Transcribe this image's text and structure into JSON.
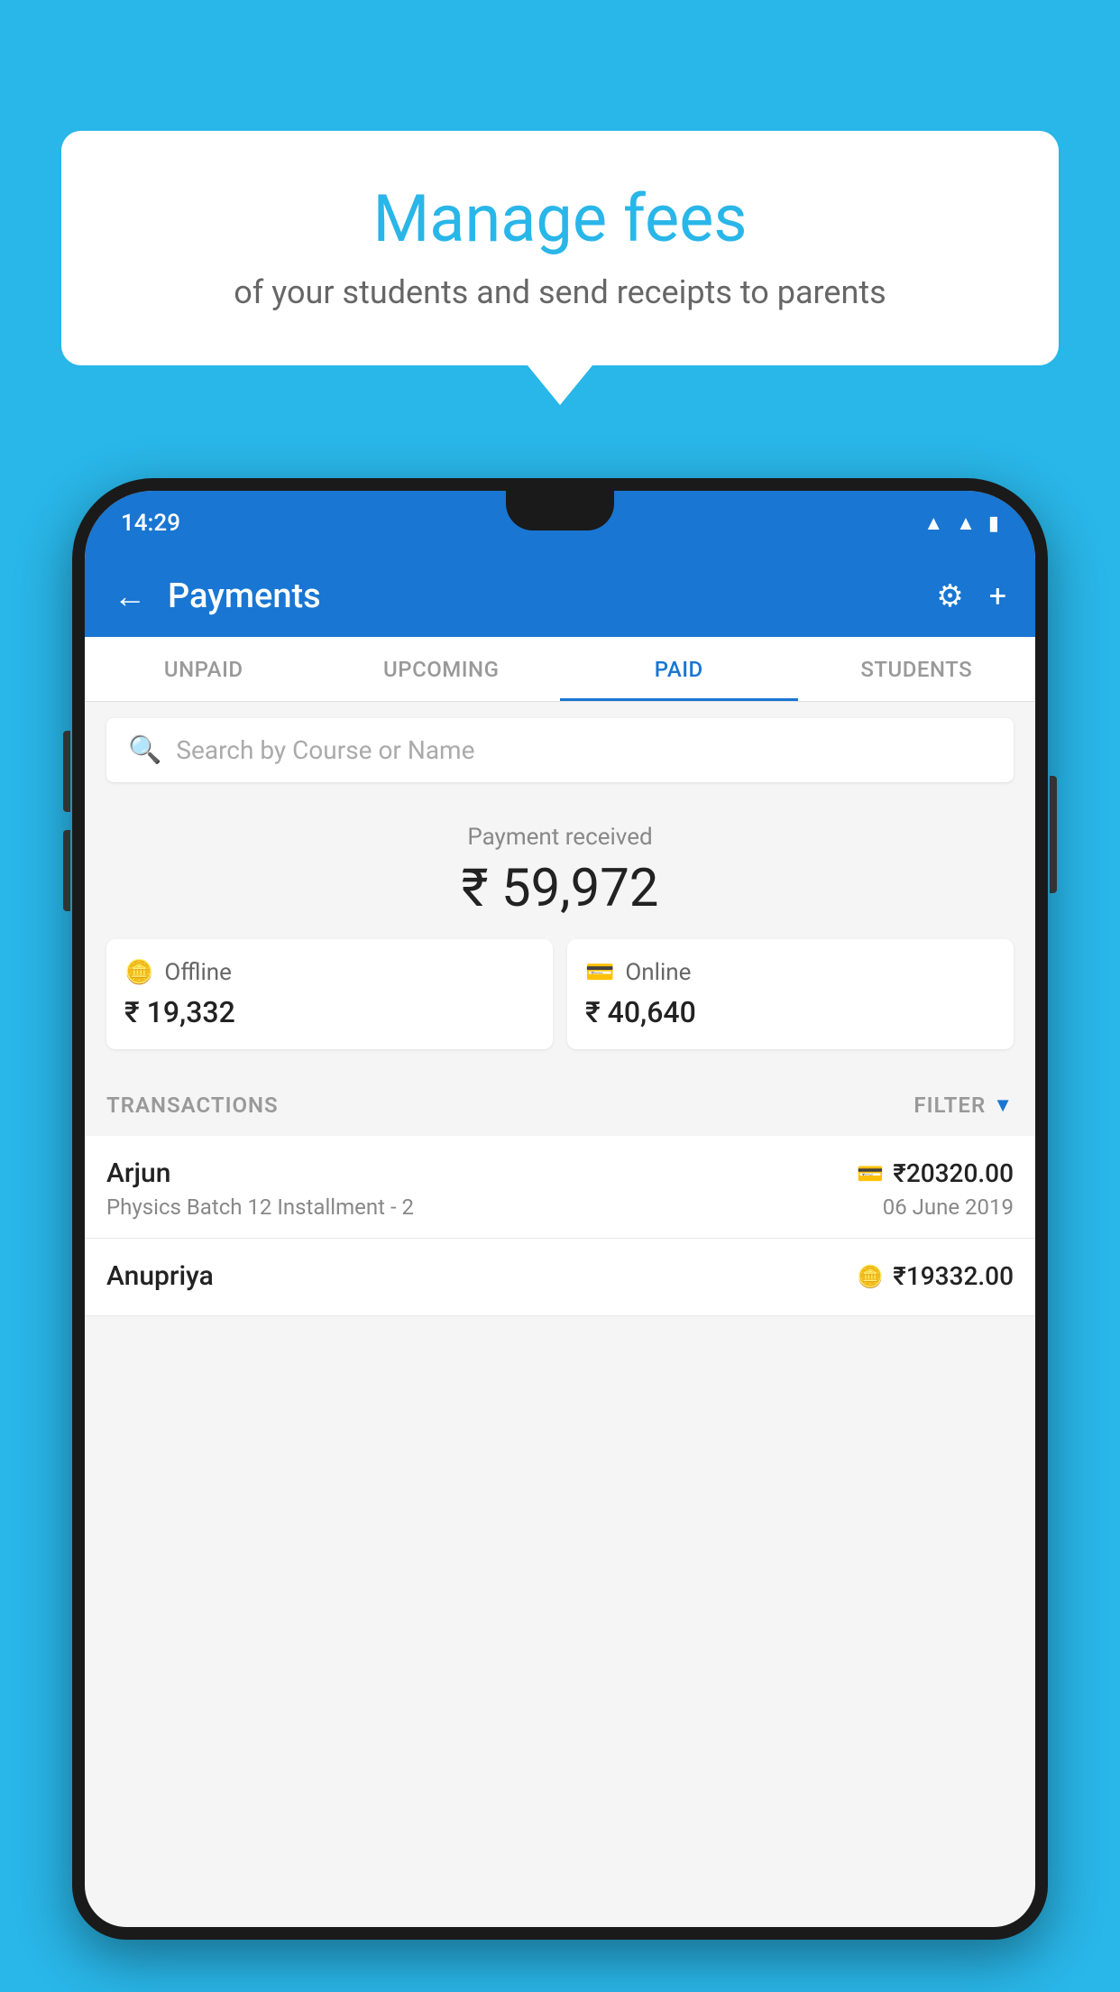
{
  "background_color": "#29b6e8",
  "speech_bubble": {
    "title": "Manage fees",
    "subtitle": "of your students and send receipts to parents"
  },
  "status_bar": {
    "time": "14:29",
    "icons": [
      "wifi",
      "signal",
      "battery"
    ]
  },
  "header": {
    "title": "Payments",
    "back_label": "←",
    "settings_label": "⚙",
    "add_label": "+"
  },
  "tabs": [
    {
      "label": "UNPAID",
      "active": false
    },
    {
      "label": "UPCOMING",
      "active": false
    },
    {
      "label": "PAID",
      "active": true
    },
    {
      "label": "STUDENTS",
      "active": false
    }
  ],
  "search": {
    "placeholder": "Search by Course or Name"
  },
  "payment_summary": {
    "received_label": "Payment received",
    "total_amount": "₹ 59,972",
    "offline": {
      "label": "Offline",
      "amount": "₹ 19,332"
    },
    "online": {
      "label": "Online",
      "amount": "₹ 40,640"
    }
  },
  "transactions_section": {
    "label": "TRANSACTIONS",
    "filter_label": "FILTER"
  },
  "transactions": [
    {
      "name": "Arjun",
      "course": "Physics Batch 12 Installment - 2",
      "amount": "₹20320.00",
      "date": "06 June 2019",
      "type": "online"
    },
    {
      "name": "Anupriya",
      "course": "",
      "amount": "₹19332.00",
      "date": "",
      "type": "offline"
    }
  ]
}
